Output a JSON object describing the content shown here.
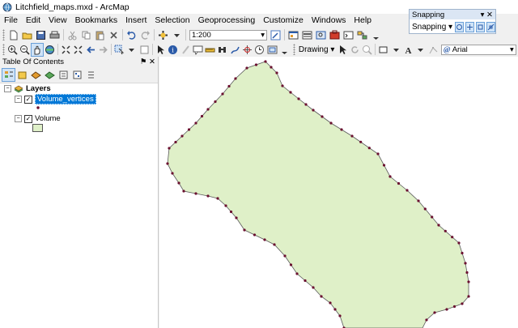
{
  "window": {
    "title": "Litchfield_maps.mxd - ArcMap"
  },
  "menu": [
    "File",
    "Edit",
    "View",
    "Bookmarks",
    "Insert",
    "Selection",
    "Geoprocessing",
    "Customize",
    "Windows",
    "Help"
  ],
  "toolbar": {
    "scale_value": "1:200",
    "drawing_label": "Drawing",
    "font_value": "Arial"
  },
  "snapping": {
    "title": "Snapping",
    "button_label": "Snapping"
  },
  "toc": {
    "title": "Table Of Contents",
    "layers_label": "Layers",
    "layers": [
      {
        "name": "Volume_vertices",
        "checked": true,
        "selected": true
      },
      {
        "name": "Volume",
        "checked": true,
        "selected": false
      }
    ]
  },
  "map": {
    "polygon_fill": "#dff0c8",
    "vertex_color": "#6b1030"
  },
  "colors": {
    "selection": "#0078d7",
    "snapping_header": "#dbe6f4"
  }
}
